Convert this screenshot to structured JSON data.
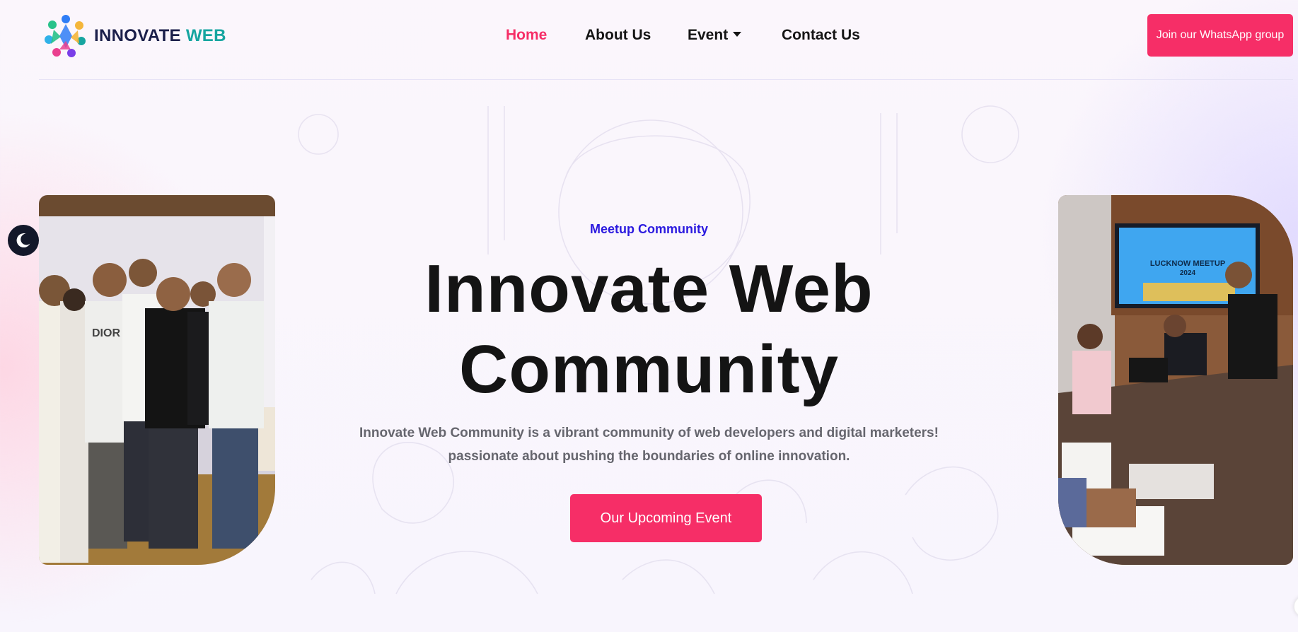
{
  "brand": {
    "name_part1": "INNOVATE",
    "name_part2": "WEB",
    "accent_color": "#f62e67",
    "teal_color": "#16a5a0",
    "navy_color": "#1b1f4a"
  },
  "nav": {
    "items": [
      {
        "label": "Home",
        "active": true
      },
      {
        "label": "About Us",
        "active": false
      },
      {
        "label": "Event",
        "active": false,
        "dropdown": true
      },
      {
        "label": "Contact Us",
        "active": false
      }
    ],
    "cta_label": "Join our WhatsApp group"
  },
  "theme_toggle": {
    "icon": "moon-icon"
  },
  "hero": {
    "eyebrow": "Meetup Community",
    "title_line1": "Innovate Web",
    "title_line2": "Community",
    "subtitle_line1": "Innovate Web Community is a vibrant community of web developers and digital marketers!",
    "subtitle_line2": "passionate about pushing the boundaries of online innovation.",
    "cta_label": "Our Upcoming Event",
    "eyebrow_color": "#2b1adf"
  },
  "photos": {
    "left": {
      "caption": "group-photo",
      "shirt_text": "DIOR"
    },
    "right": {
      "caption": "meeting-photo",
      "screen_text_line1": "LUCKNOW MEETUP",
      "screen_text_line2": "2024"
    }
  }
}
